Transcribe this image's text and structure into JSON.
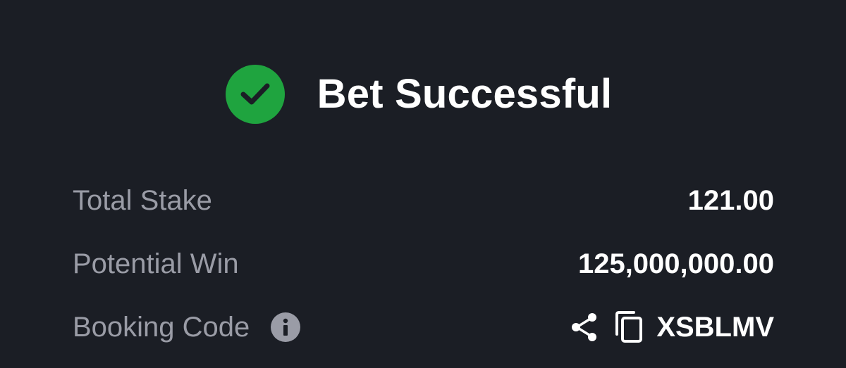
{
  "header": {
    "title": "Bet Successful",
    "icon": "check-circle-icon",
    "accent_color": "#1fa43f"
  },
  "summary": {
    "total_stake": {
      "label": "Total Stake",
      "value": "121.00"
    },
    "potential_win": {
      "label": "Potential Win",
      "value": "125,000,000.00"
    },
    "booking_code": {
      "label": "Booking Code",
      "value": "XSBLMV",
      "info_icon": "info-icon",
      "share_icon": "share-icon",
      "copy_icon": "copy-icon"
    }
  },
  "colors": {
    "background": "#1b1e25",
    "label": "#9a9ca6",
    "value": "#ffffff"
  }
}
